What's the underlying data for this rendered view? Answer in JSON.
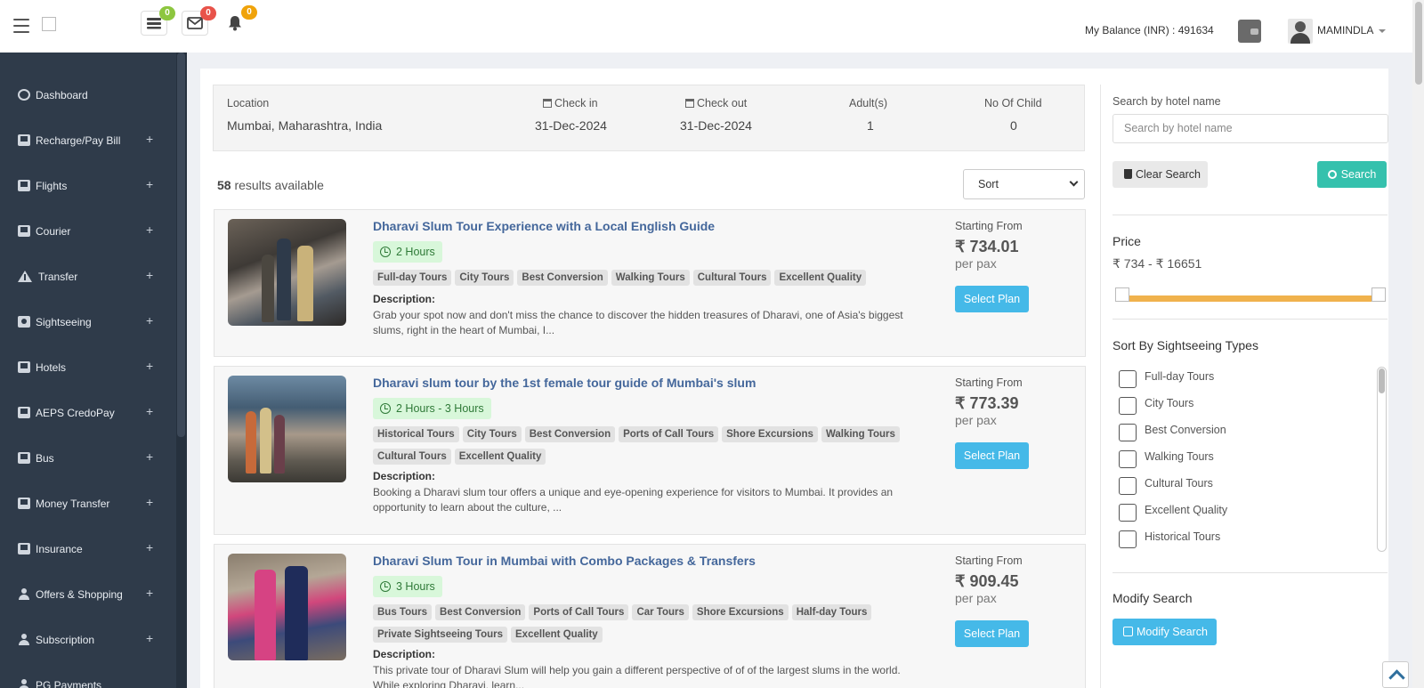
{
  "header": {
    "badges": [
      {
        "icon": "tasks-icon",
        "count": "0",
        "color": "#8dc63f"
      },
      {
        "icon": "envelope-icon",
        "count": "0",
        "color": "#e8534a"
      },
      {
        "icon": "bell-icon",
        "count": "0",
        "color": "#f0a30a"
      }
    ],
    "balance": "My Balance (INR) : 491634",
    "username": "MAMINDLA"
  },
  "sidebar": {
    "items": [
      {
        "label": "Dashboard",
        "icon": "dashboard-icon",
        "expandable": false
      },
      {
        "label": "Recharge/Pay Bill",
        "icon": "book-icon",
        "expandable": true
      },
      {
        "label": "Flights",
        "icon": "book-icon",
        "expandable": true
      },
      {
        "label": "Courier",
        "icon": "book-icon",
        "expandable": true
      },
      {
        "label": "Transfer",
        "icon": "road-icon",
        "expandable": true
      },
      {
        "label": "Sightseeing",
        "icon": "camera-icon",
        "expandable": true
      },
      {
        "label": "Hotels",
        "icon": "book-icon",
        "expandable": true
      },
      {
        "label": "AEPS CredoPay",
        "icon": "book-icon",
        "expandable": true
      },
      {
        "label": "Bus",
        "icon": "book-icon",
        "expandable": true
      },
      {
        "label": "Money Transfer",
        "icon": "book-icon",
        "expandable": true
      },
      {
        "label": "Insurance",
        "icon": "book-icon",
        "expandable": true
      },
      {
        "label": "Offers & Shopping",
        "icon": "user-icon",
        "expandable": true
      },
      {
        "label": "Subscription",
        "icon": "user-icon",
        "expandable": true
      },
      {
        "label": "PG Payments",
        "icon": "user-icon",
        "expandable": false
      }
    ],
    "plus": "+"
  },
  "search_summary": {
    "location_label": "Location",
    "location": "Mumbai, Maharashtra, India",
    "checkin_label": "Check in",
    "checkin": "31-Dec-2024",
    "checkout_label": "Check out",
    "checkout": "31-Dec-2024",
    "adults_label": "Adult(s)",
    "adults": "1",
    "child_label": "No Of Child",
    "child": "0"
  },
  "results": {
    "count": "58",
    "count_suffix": "results available",
    "sort_label": "Sort"
  },
  "cards": [
    {
      "title": "Dharavi Slum Tour Experience with a Local English Guide",
      "duration": "2 Hours",
      "tags": [
        "Full-day Tours",
        "City Tours",
        "Best Conversion",
        "Walking Tours",
        "Cultural Tours",
        "Excellent Quality"
      ],
      "desc_heading": "Description:",
      "description": "Grab your spot now and don't miss the chance to discover the hidden treasures of Dharavi, one of Asia's biggest slums, right in the heart of Mumbai, I...",
      "starting_from": "Starting From",
      "price": "₹ 734.01",
      "per": "per pax",
      "button": "Select Plan"
    },
    {
      "title": "Dharavi slum tour by the 1st female tour guide of Mumbai's slum",
      "duration": "2 Hours - 3 Hours",
      "tags": [
        "Historical Tours",
        "City Tours",
        "Best Conversion",
        "Ports of Call Tours",
        "Shore Excursions",
        "Walking Tours",
        "Cultural Tours",
        "Excellent Quality"
      ],
      "desc_heading": "Description:",
      "description": "Booking a Dharavi slum tour offers a unique and eye-opening experience for visitors to Mumbai. It provides an opportunity to learn about the culture, ...",
      "starting_from": "Starting From",
      "price": "₹ 773.39",
      "per": "per pax",
      "button": "Select Plan"
    },
    {
      "title": "Dharavi Slum Tour in Mumbai with Combo Packages & Transfers",
      "duration": "3 Hours",
      "tags": [
        "Bus Tours",
        "Best Conversion",
        "Ports of Call Tours",
        "Car Tours",
        "Shore Excursions",
        "Half-day Tours",
        "Private Sightseeing Tours",
        "Excellent Quality"
      ],
      "desc_heading": "Description:",
      "description": "This private tour of Dharavi Slum will help you gain a different perspective of of of the largest slums in the world. While exploring Dharavi, learn...",
      "starting_from": "Starting From",
      "price": "₹ 909.45",
      "per": "per pax",
      "button": "Select Plan"
    }
  ],
  "filters": {
    "hotel_search_label": "Search by hotel name",
    "hotel_search_placeholder": "Search by hotel name",
    "clear_button": "Clear Search",
    "search_button": "Search",
    "price_heading": "Price",
    "price_range": "₹ 734 - ₹ 16651",
    "price_min": 734,
    "price_max": 16651,
    "types_heading": "Sort By Sightseeing Types",
    "types": [
      "Full-day Tours",
      "City Tours",
      "Best Conversion",
      "Walking Tours",
      "Cultural Tours",
      "Excellent Quality",
      "Historical Tours"
    ],
    "modify_heading": "Modify Search",
    "modify_button": "Modify Search"
  }
}
